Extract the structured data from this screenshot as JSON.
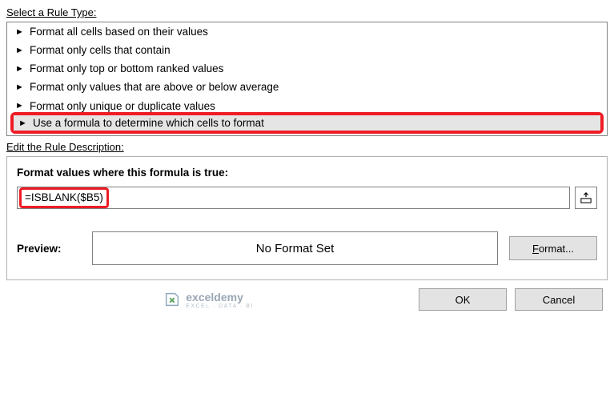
{
  "labels": {
    "select_rule_type": "Select a Rule Type:",
    "edit_rule_desc": "Edit the Rule Description:",
    "formula_true": "Format values where this formula is true:",
    "preview": "Preview:",
    "no_format": "No Format Set",
    "format_btn": "Format...",
    "ok": "OK",
    "cancel": "Cancel"
  },
  "rule_types": {
    "r0": "Format all cells based on their values",
    "r1": "Format only cells that contain",
    "r2": "Format only top or bottom ranked values",
    "r3": "Format only values that are above or below average",
    "r4": "Format only unique or duplicate values",
    "r5": "Use a formula to determine which cells to format"
  },
  "formula": {
    "value": "=ISBLANK($B5)"
  },
  "watermark": {
    "brand": "exceldemy",
    "tag": "EXCEL · DATA · BI"
  }
}
